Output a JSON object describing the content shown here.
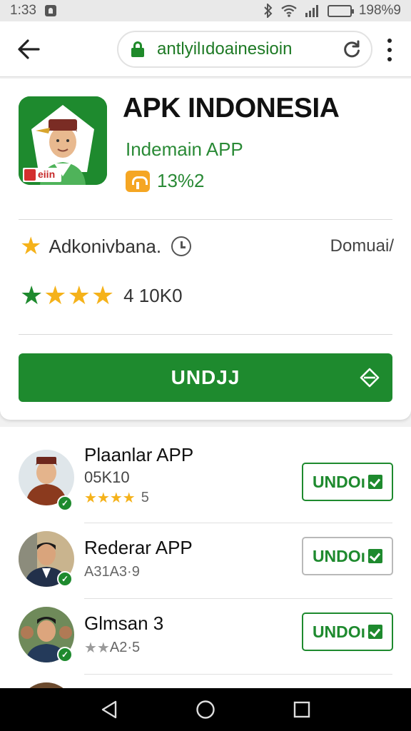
{
  "status_bar": {
    "time": "1:33",
    "battery_text": "198%9",
    "icons": [
      "notification-icon",
      "bluetooth-icon",
      "wifi-icon",
      "signal-icon",
      "battery-icon"
    ]
  },
  "browser": {
    "url": "antlyilıdoainesioin",
    "icons": [
      "back-arrow-icon",
      "lock-icon",
      "reload-icon",
      "more-vert-icon"
    ],
    "accent_color": "#1e8a2e"
  },
  "app": {
    "title": "APK INDONESIA",
    "developer": "Indemain APP",
    "size": "13%2",
    "icon_badge": "eiin",
    "info_label": "Adkonivbana.",
    "info_right": "Domuai/",
    "rating_stars": 4,
    "rating_text": "4  10K0",
    "download_label": "UNDJJ"
  },
  "list": {
    "items": [
      {
        "name": "Plaanlar APP",
        "sub": "05K10",
        "rating_stars": "★★★★",
        "rating_value": "5",
        "button_label": "UNDOı",
        "button_style": "green"
      },
      {
        "name": "Rederar APP",
        "sub": "",
        "rating_stars": "",
        "rating_value": "A31A3·9",
        "button_label": "UNDOı",
        "button_style": "grey"
      },
      {
        "name": "Glmsan 3",
        "sub": "",
        "rating_stars": "★★",
        "rating_value": "A2·5",
        "button_label": "UNDOı",
        "button_style": "green"
      }
    ]
  },
  "nav": {
    "icons": [
      "nav-back-icon",
      "nav-home-icon",
      "nav-recents-icon"
    ]
  }
}
